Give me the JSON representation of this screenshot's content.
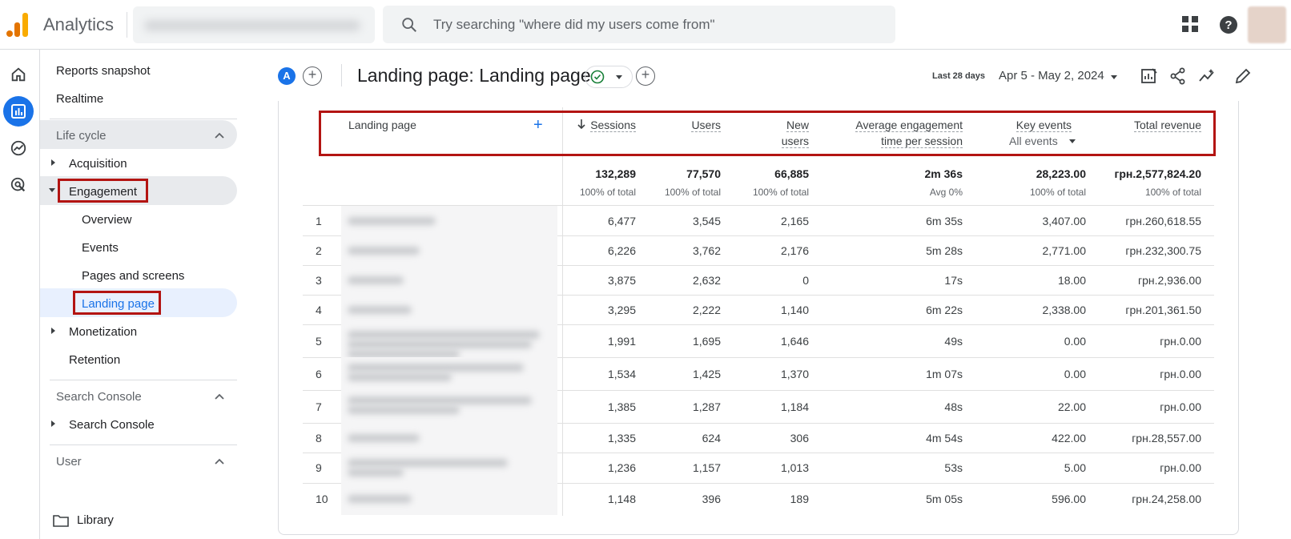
{
  "topbar": {
    "app_title": "Analytics",
    "search_placeholder": "Try searching \"where did my users come from\""
  },
  "sidenav": {
    "reports_snapshot": "Reports snapshot",
    "realtime": "Realtime",
    "section_lifecycle": "Life cycle",
    "acquisition": "Acquisition",
    "engagement": "Engagement",
    "overview": "Overview",
    "events": "Events",
    "pages_and_screens": "Pages and screens",
    "landing_page": "Landing page",
    "monetization": "Monetization",
    "retention": "Retention",
    "section_search_console": "Search Console",
    "search_console": "Search Console",
    "section_user": "User",
    "library": "Library"
  },
  "report": {
    "chip_letter": "A",
    "title": "Landing page: Landing page",
    "date_label": "Last 28 days",
    "date_range": "Apr 5 - May 2, 2024"
  },
  "table": {
    "dimension_header": "Landing page",
    "headers": {
      "sessions": "Sessions",
      "users": "Users",
      "new_users_1": "New",
      "new_users_2": "users",
      "aet_1": "Average engagement",
      "aet_2": "time per session",
      "key_events": "Key events",
      "key_events_filter": "All events",
      "total_revenue": "Total revenue"
    },
    "totals": {
      "sessions": "132,289",
      "users": "77,570",
      "new_users": "66,885",
      "aet": "2m 36s",
      "key_events": "28,223.00",
      "revenue": "грн.2,577,824.20",
      "sessions_sub": "100% of total",
      "users_sub": "100% of total",
      "new_users_sub": "100% of total",
      "aet_sub": "Avg 0%",
      "key_events_sub": "100% of total",
      "revenue_sub": "100% of total"
    },
    "rows": [
      {
        "n": "1",
        "sessions": "6,477",
        "users": "3,545",
        "new_users": "2,165",
        "aet": "6m 35s",
        "key_events": "3,407.00",
        "revenue": "грн.260,618.55"
      },
      {
        "n": "2",
        "sessions": "6,226",
        "users": "3,762",
        "new_users": "2,176",
        "aet": "5m 28s",
        "key_events": "2,771.00",
        "revenue": "грн.232,300.75"
      },
      {
        "n": "3",
        "sessions": "3,875",
        "users": "2,632",
        "new_users": "0",
        "aet": "17s",
        "key_events": "18.00",
        "revenue": "грн.2,936.00"
      },
      {
        "n": "4",
        "sessions": "3,295",
        "users": "2,222",
        "new_users": "1,140",
        "aet": "6m 22s",
        "key_events": "2,338.00",
        "revenue": "грн.201,361.50"
      },
      {
        "n": "5",
        "sessions": "1,991",
        "users": "1,695",
        "new_users": "1,646",
        "aet": "49s",
        "key_events": "0.00",
        "revenue": "грн.0.00"
      },
      {
        "n": "6",
        "sessions": "1,534",
        "users": "1,425",
        "new_users": "1,370",
        "aet": "1m 07s",
        "key_events": "0.00",
        "revenue": "грн.0.00"
      },
      {
        "n": "7",
        "sessions": "1,385",
        "users": "1,287",
        "new_users": "1,184",
        "aet": "48s",
        "key_events": "22.00",
        "revenue": "грн.0.00"
      },
      {
        "n": "8",
        "sessions": "1,335",
        "users": "624",
        "new_users": "306",
        "aet": "4m 54s",
        "key_events": "422.00",
        "revenue": "грн.28,557.00"
      },
      {
        "n": "9",
        "sessions": "1,236",
        "users": "1,157",
        "new_users": "1,013",
        "aet": "53s",
        "key_events": "5.00",
        "revenue": "грн.0.00"
      },
      {
        "n": "10",
        "sessions": "1,148",
        "users": "396",
        "new_users": "189",
        "aet": "5m 05s",
        "key_events": "596.00",
        "revenue": "грн.24,258.00"
      }
    ]
  },
  "colors": {
    "accent": "#1a73e8",
    "highlight_border": "#b31412",
    "logo_orange": "#f9ab00",
    "logo_dark_orange": "#e37400"
  }
}
